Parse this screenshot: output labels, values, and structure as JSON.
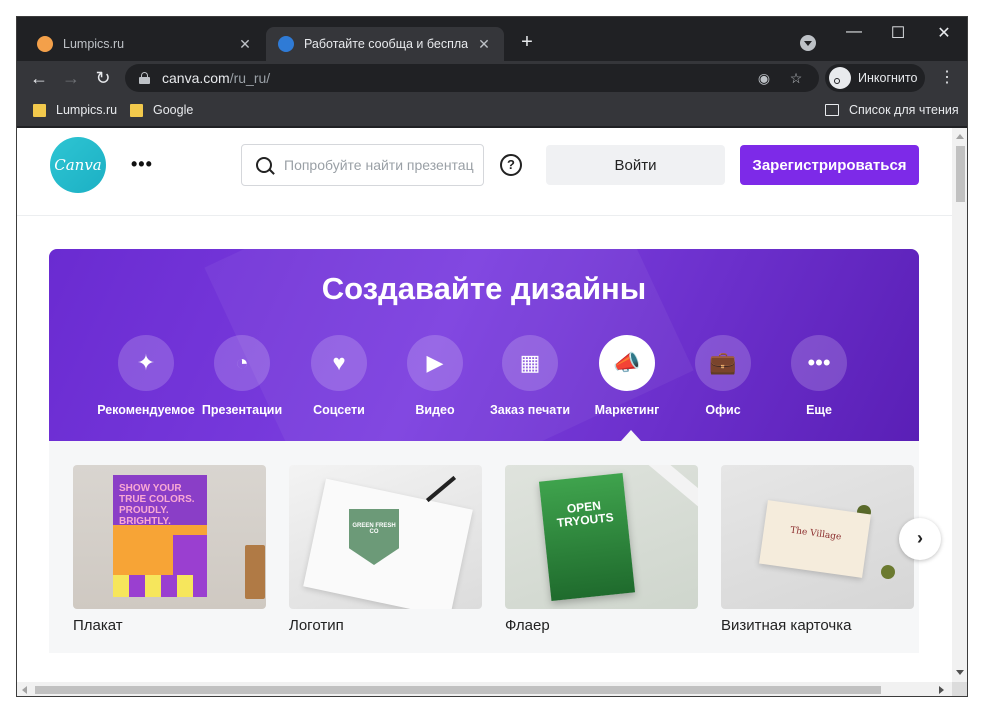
{
  "browser": {
    "tabs": [
      {
        "title": "Lumpics.ru",
        "fav_color": "#f3a04a"
      },
      {
        "title": "Работайте сообща и бесплатно",
        "fav_color": "#2f7bd6"
      }
    ],
    "new_tab": "+",
    "window_controls": {
      "minimize": "—",
      "maximize": "☐",
      "close": "✕"
    },
    "address": {
      "host": "canva.com",
      "path": "/ru_ru/"
    },
    "incognito_label": "Инкогнито",
    "bookmarks": [
      {
        "label": "Lumpics.ru"
      },
      {
        "label": "Google"
      }
    ],
    "reading_list_label": "Список для чтения"
  },
  "header": {
    "logo_text": "Canva",
    "search_placeholder": "Попробуйте найти презентации",
    "help": "?",
    "login_label": "Войти",
    "signup_label": "Зарегистрироваться"
  },
  "hero": {
    "title": "Создавайте дизайны",
    "categories": [
      {
        "label": "Рекомендуемое",
        "icon": "sparkle-icon",
        "glyph": "✦"
      },
      {
        "label": "Презентации",
        "icon": "presentation-icon",
        "glyph": "◔"
      },
      {
        "label": "Соцсети",
        "icon": "heart-icon",
        "glyph": "♥"
      },
      {
        "label": "Видео",
        "icon": "video-camera-icon",
        "glyph": "▶"
      },
      {
        "label": "Заказ печати",
        "icon": "print-icon",
        "glyph": "▦"
      },
      {
        "label": "Маркетинг",
        "icon": "megaphone-icon",
        "glyph": "📣",
        "active": true
      },
      {
        "label": "Офис",
        "icon": "briefcase-icon",
        "glyph": "💼"
      },
      {
        "label": "Еще",
        "icon": "more-icon",
        "glyph": "•••"
      }
    ]
  },
  "cards": [
    {
      "label": "Плакат",
      "art_text": "SHOW YOUR TRUE COLORS. PROUDLY. BRIGHTLY."
    },
    {
      "label": "Логотип",
      "art_text": "GREEN FRESH CO"
    },
    {
      "label": "Флаер",
      "art_text": "OPEN TRYOUTS"
    },
    {
      "label": "Визитная карточка",
      "art_text": "The Village"
    }
  ],
  "next_arrow": "›",
  "colors": {
    "brand_purple": "#7d2ae8",
    "brand_teal": "#20c4cb",
    "chrome_dark": "#202124",
    "chrome_toolbar": "#35363a"
  }
}
